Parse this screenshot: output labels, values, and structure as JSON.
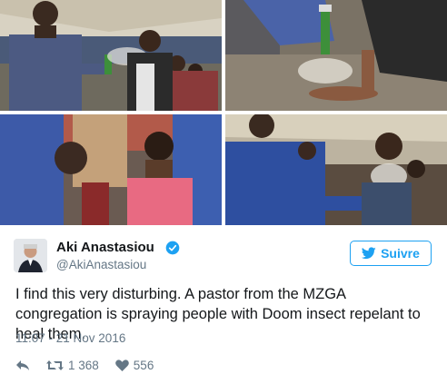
{
  "tweet": {
    "display_name": "Aki Anastasiou",
    "handle": "@AkiAnastasiou",
    "follow_label": "Suivre",
    "text": "I find this very disturbing. A pastor from the MZGA congregation is spraying people with Doom insect repelant to heal them.",
    "timestamp": "11:07 - 21 Nov 2016",
    "retweets": "1 368",
    "likes": "556"
  },
  "icons": {
    "verified": "verified-badge-icon",
    "follow": "twitter-bird-icon",
    "reply": "reply-arrow-icon",
    "retweet": "retweet-icon",
    "like": "heart-icon"
  },
  "colors": {
    "accent": "#1da1f2",
    "text": "#14171a",
    "muted": "#657786"
  },
  "photos": [
    {
      "name": "photo-pastor-spraying-woman"
    },
    {
      "name": "photo-spray-on-feet"
    },
    {
      "name": "photo-woman-pink-top"
    },
    {
      "name": "photo-pastor-spraying-face"
    }
  ]
}
